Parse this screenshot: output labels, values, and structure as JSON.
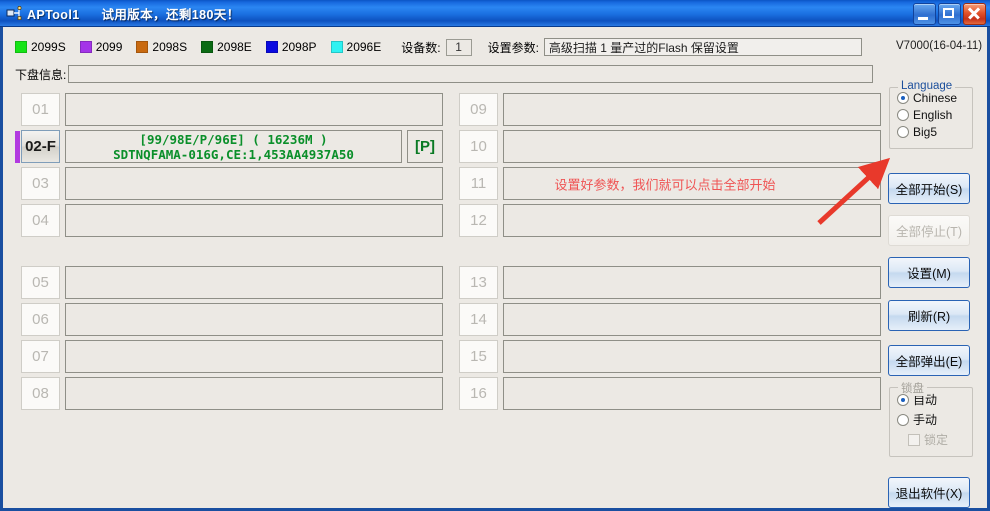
{
  "window": {
    "title": "APTool1",
    "subtitle": "试用版本，还剩180天！",
    "icon": "usb-device-icon",
    "minimize_label": "",
    "maximize_label": "",
    "close_label": ""
  },
  "legend": [
    {
      "label": "2099S",
      "color": "#16e416"
    },
    {
      "label": "2099",
      "color": "#a435e8"
    },
    {
      "label": "2098S",
      "color": "#c96a10"
    },
    {
      "label": "2098E",
      "color": "#0b6b14"
    },
    {
      "label": "2098P",
      "color": "#0a0ae0"
    },
    {
      "label": "2096E",
      "color": "#2ef2f2"
    }
  ],
  "toolbar": {
    "device_count_label": "设备数:",
    "device_count_value": "1",
    "param_label": "设置参数:",
    "param_value": "高级扫描 1 量产过的Flash 保留设置",
    "version": "V7000(16-04-11)",
    "info_label": "下盘信息:",
    "info_value": ""
  },
  "slots_left": [
    {
      "num": "01",
      "active": false,
      "marker": false,
      "text": "",
      "badge": ""
    },
    {
      "num": "02-F",
      "active": true,
      "marker": true,
      "marker_color": "#b23ae0",
      "text": "[99/98E/P/96E] ( 16236M )\nSDTNQFAMA-016G,CE:1,453AA4937A50",
      "badge": "[P]"
    },
    {
      "num": "03",
      "active": false,
      "marker": false,
      "text": "",
      "badge": ""
    },
    {
      "num": "04",
      "active": false,
      "marker": false,
      "text": "",
      "badge": ""
    },
    {
      "num": "05",
      "active": false,
      "marker": false,
      "text": "",
      "badge": ""
    },
    {
      "num": "06",
      "active": false,
      "marker": false,
      "text": "",
      "badge": ""
    },
    {
      "num": "07",
      "active": false,
      "marker": false,
      "text": "",
      "badge": ""
    },
    {
      "num": "08",
      "active": false,
      "marker": false,
      "text": "",
      "badge": ""
    }
  ],
  "slots_right": [
    {
      "num": "09",
      "active": false,
      "marker": false,
      "text": "",
      "badge": ""
    },
    {
      "num": "10",
      "active": false,
      "marker": false,
      "text": "",
      "badge": ""
    },
    {
      "num": "11",
      "active": false,
      "marker": false,
      "text": "",
      "badge": ""
    },
    {
      "num": "12",
      "active": false,
      "marker": false,
      "text": "",
      "badge": ""
    },
    {
      "num": "13",
      "active": false,
      "marker": false,
      "text": "",
      "badge": ""
    },
    {
      "num": "14",
      "active": false,
      "marker": false,
      "text": "",
      "badge": ""
    },
    {
      "num": "15",
      "active": false,
      "marker": false,
      "text": "",
      "badge": ""
    },
    {
      "num": "16",
      "active": false,
      "marker": false,
      "text": "",
      "badge": ""
    }
  ],
  "annotation": {
    "text": "设置好参数，我们就可以点击全部开始",
    "color": "#ef5454",
    "arrow_color": "#e8392b"
  },
  "language": {
    "title": "Language",
    "options": [
      {
        "label": "Chinese",
        "selected": true
      },
      {
        "label": "English",
        "selected": false
      },
      {
        "label": "Big5",
        "selected": false
      }
    ]
  },
  "lock": {
    "title": "锁盘",
    "options": [
      {
        "label": "自动",
        "selected": true
      },
      {
        "label": "手动",
        "selected": false
      }
    ],
    "checkbox_label": "锁定",
    "checkbox_checked": false
  },
  "buttons": {
    "start_all": "全部开始(S)",
    "stop_all": "全部停止(T)",
    "settings": "设置(M)",
    "refresh": "刷新(R)",
    "eject_all": "全部弹出(E)",
    "exit": "退出软件(X)"
  }
}
